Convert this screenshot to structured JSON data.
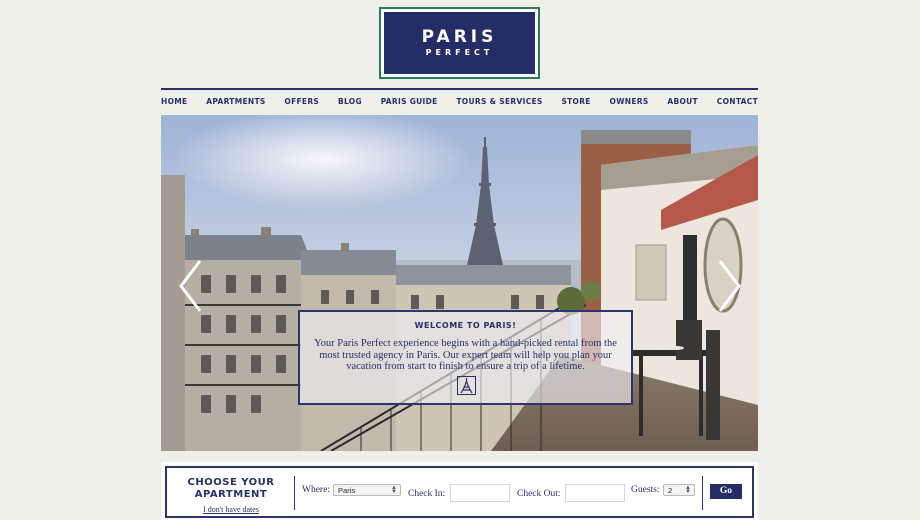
{
  "brand": {
    "title": "PARIS",
    "subtitle": "PERFECT"
  },
  "nav": {
    "items": [
      {
        "label": "HOME"
      },
      {
        "label": "APARTMENTS"
      },
      {
        "label": "OFFERS"
      },
      {
        "label": "BLOG"
      },
      {
        "label": "PARIS GUIDE"
      },
      {
        "label": "TOURS & SERVICES"
      },
      {
        "label": "STORE"
      },
      {
        "label": "OWNERS"
      },
      {
        "label": "ABOUT"
      },
      {
        "label": "CONTACT"
      }
    ]
  },
  "hero": {
    "prev_icon": "chevron-left-icon",
    "next_icon": "chevron-right-icon",
    "welcome": {
      "title": "WELCOME TO PARIS!",
      "text": "Your Paris Perfect experience begins with a hand-picked rental from the most trusted agency in Paris. Our expert team will help you plan your vacation from start to finish to ensure a trip of a lifetime.",
      "icon": "eiffel-tower-icon"
    }
  },
  "search": {
    "title_line1": "CHOOSE YOUR",
    "title_line2": "APARTMENT",
    "no_dates": "I don't have dates",
    "where_label": "Where:",
    "where_value": "Paris",
    "checkin_label": "Check In:",
    "checkin_value": "",
    "checkout_label": "Check Out:",
    "checkout_value": "",
    "guests_label": "Guests:",
    "guests_value": "2",
    "go_label": "Go"
  },
  "colors": {
    "navy": "#252d66",
    "logo_border": "#2a7a5a",
    "background": "#efefea"
  }
}
